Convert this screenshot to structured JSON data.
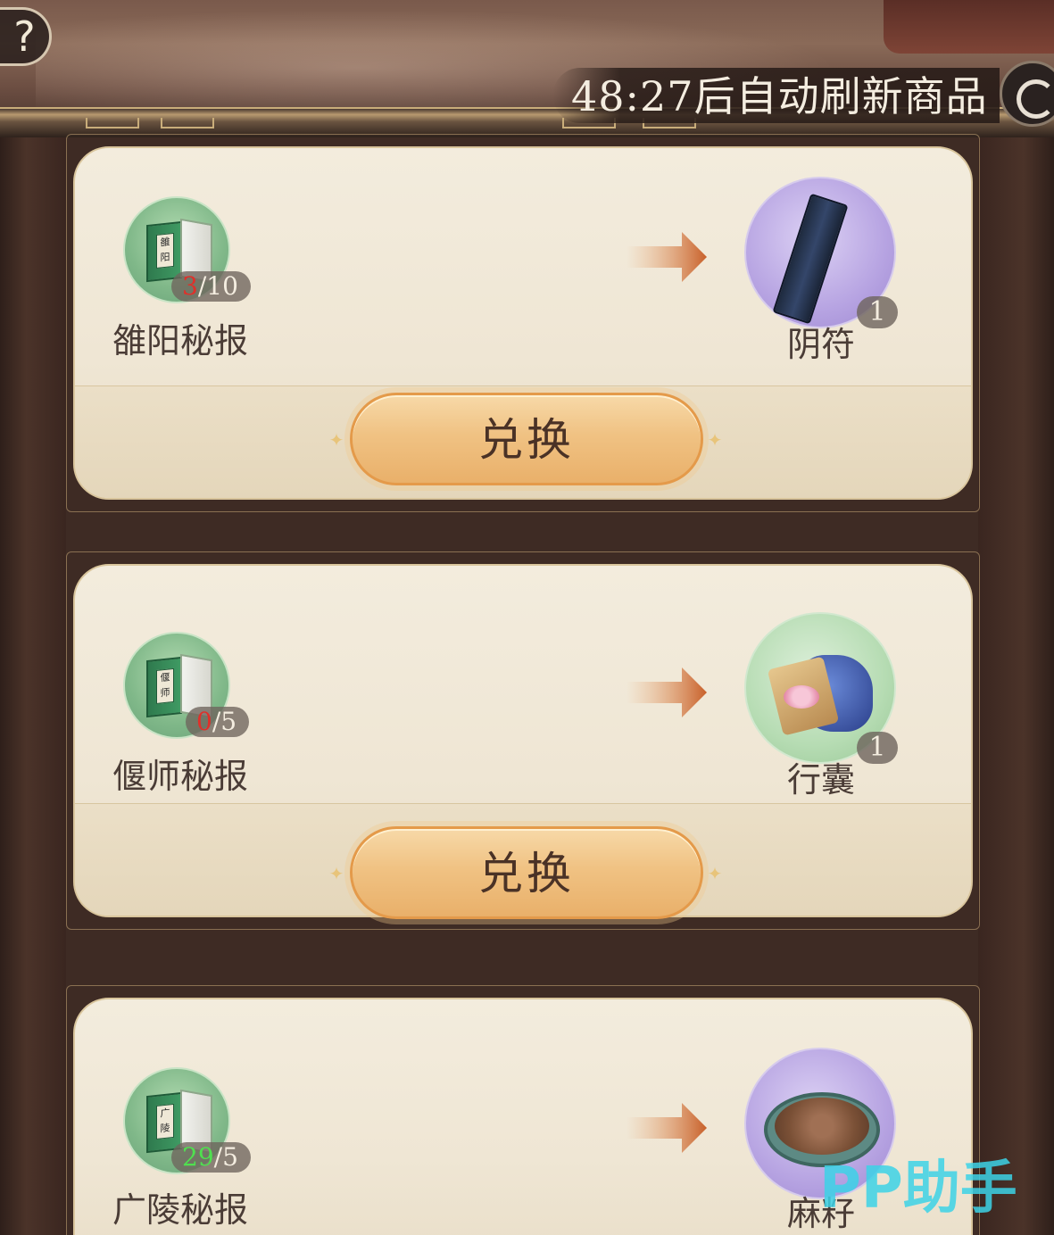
{
  "header": {
    "help_label": "?",
    "refresh_text": "48:27后自动刷新商品",
    "refresh_icon": "refresh-icon"
  },
  "exchanges": [
    {
      "cost_name": "雒阳秘报",
      "cost_book_tag": "雒阳",
      "cost_have": "3",
      "cost_need": "/10",
      "cost_have_color": "red",
      "reward_name": "阴符",
      "reward_qty": "1",
      "reward_circle": "purple",
      "button_label": "兑换"
    },
    {
      "cost_name": "偃师秘报",
      "cost_book_tag": "偃师",
      "cost_have": "0",
      "cost_need": "/5",
      "cost_have_color": "red",
      "reward_name": "行囊",
      "reward_qty": "1",
      "reward_circle": "mint",
      "button_label": "兑换"
    },
    {
      "cost_name": "广陵秘报",
      "cost_book_tag": "广陵",
      "cost_have": "29",
      "cost_need": "/5",
      "cost_have_color": "green",
      "reward_name": "麻籽",
      "reward_qty": "",
      "reward_circle": "purple",
      "button_label": "兑换"
    }
  ],
  "watermark": "PP助手",
  "colors": {
    "count_red": "#e0302a",
    "count_green": "#4fe04f",
    "button_gold": "#f0c283",
    "watermark": "#3cd2e6"
  }
}
